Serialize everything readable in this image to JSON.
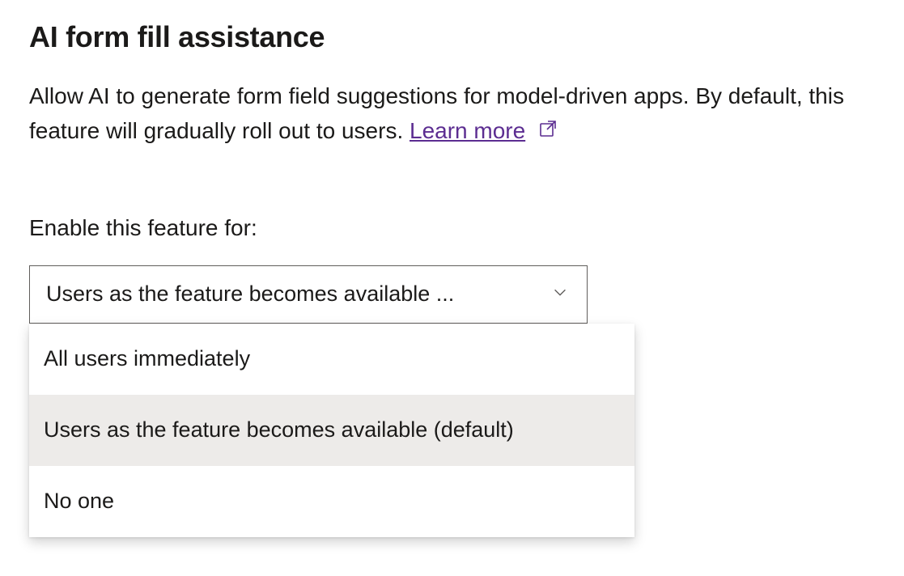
{
  "heading": "AI form fill assistance",
  "description": {
    "text_before": "Allow AI to generate form field suggestions for model-driven apps. By default, this feature will gradually roll out to users. ",
    "link_text": "Learn more"
  },
  "field_label": "Enable this feature for:",
  "select": {
    "display_value": "Users as the feature becomes available ...",
    "options": [
      {
        "label": "All users immediately",
        "selected": false
      },
      {
        "label": "Users as the feature becomes available (default)",
        "selected": true
      },
      {
        "label": "No one",
        "selected": false
      }
    ]
  },
  "colors": {
    "link": "#5c2d91",
    "border": "#605e5c",
    "selected_bg": "#edebe9"
  }
}
